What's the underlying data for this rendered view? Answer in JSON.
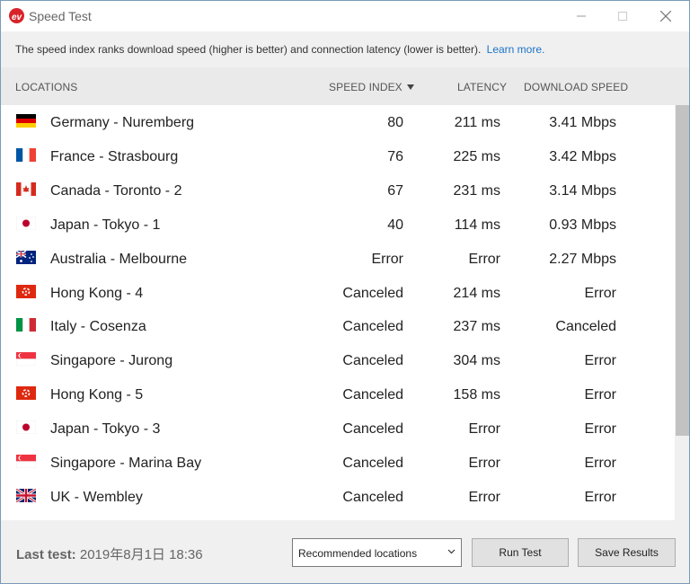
{
  "window": {
    "title": "Speed Test"
  },
  "banner": {
    "text": "The speed index ranks download speed (higher is better) and connection latency (lower is better).",
    "link_label": "Learn more."
  },
  "columns": {
    "locations": "LOCATIONS",
    "speed_index": "SPEED INDEX",
    "latency": "LATENCY",
    "download_speed": "DOWNLOAD SPEED"
  },
  "rows": [
    {
      "flag": "germany-flag",
      "location": "Germany - Nuremberg",
      "speed_index": "80",
      "latency": "211 ms",
      "download": "3.41 Mbps"
    },
    {
      "flag": "france-flag",
      "location": "France - Strasbourg",
      "speed_index": "76",
      "latency": "225 ms",
      "download": "3.42 Mbps"
    },
    {
      "flag": "canada-flag",
      "location": "Canada - Toronto - 2",
      "speed_index": "67",
      "latency": "231 ms",
      "download": "3.14 Mbps"
    },
    {
      "flag": "japan-flag",
      "location": "Japan - Tokyo - 1",
      "speed_index": "40",
      "latency": "114 ms",
      "download": "0.93 Mbps"
    },
    {
      "flag": "australia-flag",
      "location": "Australia - Melbourne",
      "speed_index": "Error",
      "latency": "Error",
      "download": "2.27 Mbps"
    },
    {
      "flag": "hongkong-flag",
      "location": "Hong Kong - 4",
      "speed_index": "Canceled",
      "latency": "214 ms",
      "download": "Error"
    },
    {
      "flag": "italy-flag",
      "location": "Italy - Cosenza",
      "speed_index": "Canceled",
      "latency": "237 ms",
      "download": "Canceled"
    },
    {
      "flag": "singapore-flag",
      "location": "Singapore - Jurong",
      "speed_index": "Canceled",
      "latency": "304 ms",
      "download": "Error"
    },
    {
      "flag": "hongkong-flag",
      "location": "Hong Kong - 5",
      "speed_index": "Canceled",
      "latency": "158 ms",
      "download": "Error"
    },
    {
      "flag": "japan-flag",
      "location": "Japan - Tokyo - 3",
      "speed_index": "Canceled",
      "latency": "Error",
      "download": "Error"
    },
    {
      "flag": "singapore-flag",
      "location": "Singapore - Marina Bay",
      "speed_index": "Canceled",
      "latency": "Error",
      "download": "Error"
    },
    {
      "flag": "uk-flag",
      "location": "UK - Wembley",
      "speed_index": "Canceled",
      "latency": "Error",
      "download": "Error"
    }
  ],
  "footer": {
    "last_test_label": "Last test:",
    "last_test_value": "2019年8月1日 18:36",
    "locations_select": "Recommended locations",
    "run_button": "Run Test",
    "save_button": "Save Results"
  },
  "colors": {
    "brand_red": "#d8232a",
    "link_blue": "#1a73c8",
    "scroll_thumb": "#c2c2c2"
  }
}
